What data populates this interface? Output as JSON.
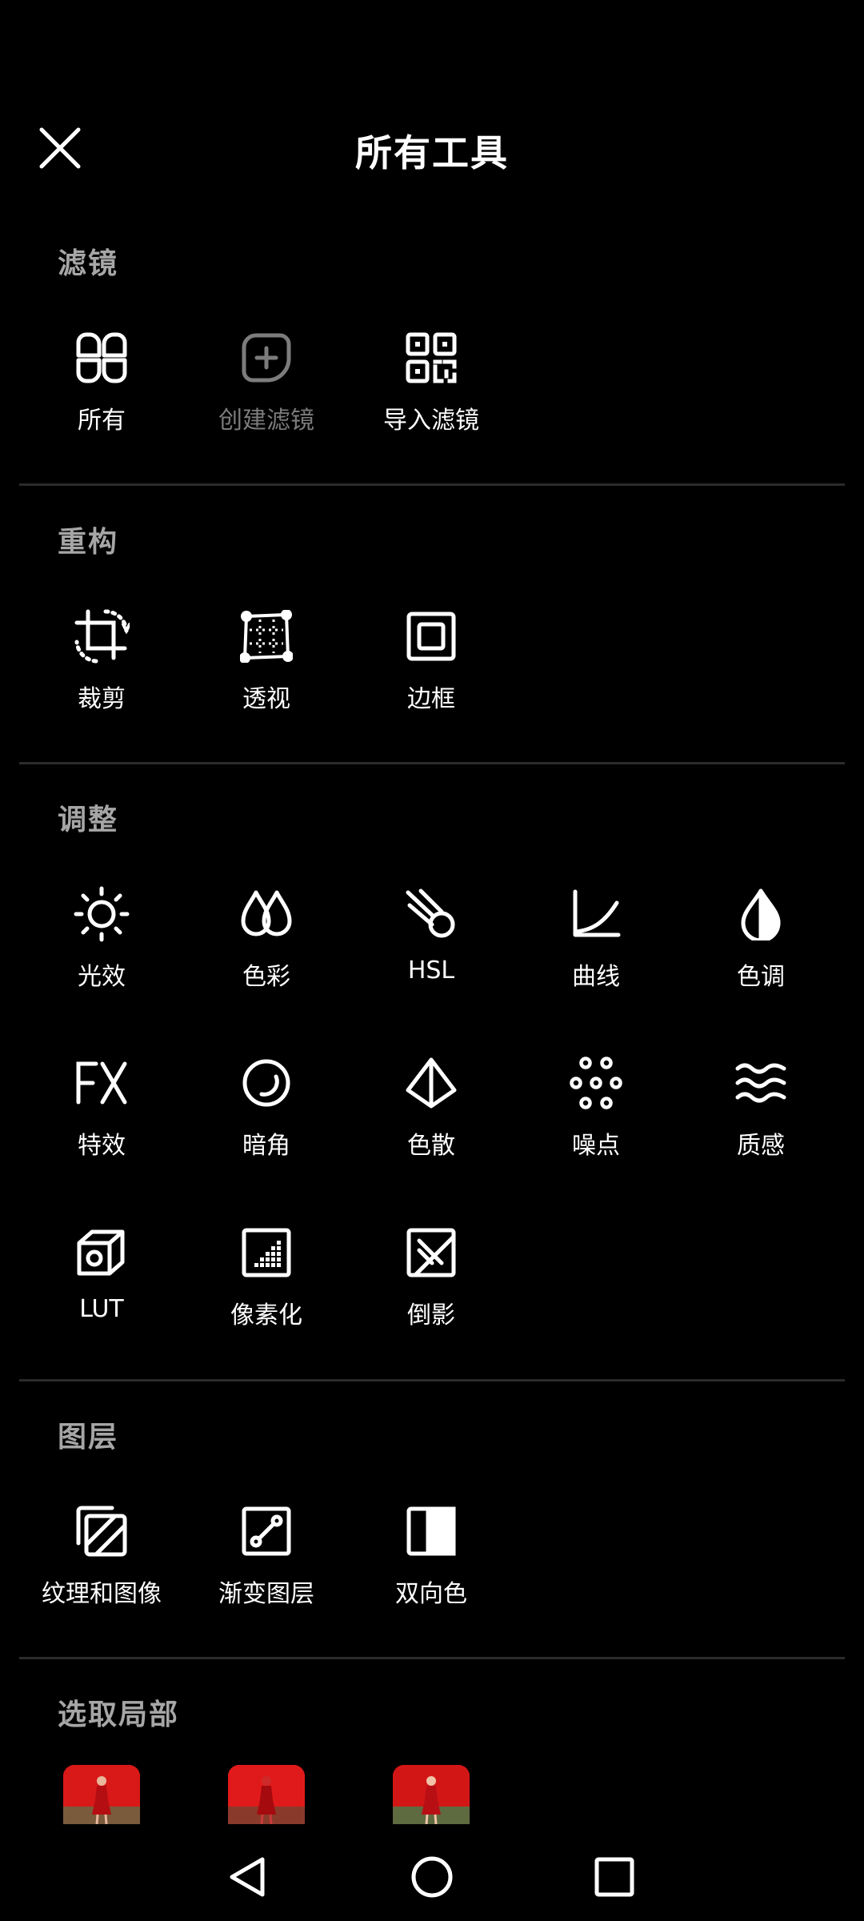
{
  "header": {
    "title": "所有工具",
    "close_icon": "close-icon"
  },
  "sections": {
    "filters": {
      "title": "滤镜",
      "items": [
        {
          "label": "所有",
          "icon": "grid-petals-icon",
          "enabled": true
        },
        {
          "label": "创建滤镜",
          "icon": "add-filter-icon",
          "enabled": false
        },
        {
          "label": "导入滤镜",
          "icon": "qr-code-icon",
          "enabled": true
        }
      ]
    },
    "reconstruct": {
      "title": "重构",
      "items": [
        {
          "label": "裁剪",
          "icon": "crop-rotate-icon"
        },
        {
          "label": "透视",
          "icon": "perspective-grid-icon"
        },
        {
          "label": "边框",
          "icon": "border-frame-icon"
        }
      ]
    },
    "adjust": {
      "title": "调整",
      "items": [
        {
          "label": "光效",
          "icon": "sun-icon"
        },
        {
          "label": "色彩",
          "icon": "color-drops-icon"
        },
        {
          "label": "HSL",
          "icon": "hsl-comet-icon"
        },
        {
          "label": "曲线",
          "icon": "curve-icon"
        },
        {
          "label": "色调",
          "icon": "tone-drop-icon"
        },
        {
          "label": "特效",
          "icon": "fx-icon"
        },
        {
          "label": "暗角",
          "icon": "vignette-icon"
        },
        {
          "label": "色散",
          "icon": "prism-icon"
        },
        {
          "label": "噪点",
          "icon": "noise-dots-icon"
        },
        {
          "label": "质感",
          "icon": "waves-icon"
        },
        {
          "label": "LUT",
          "icon": "lut-cube-icon"
        },
        {
          "label": "像素化",
          "icon": "pixelate-icon"
        },
        {
          "label": "倒影",
          "icon": "reflection-icon"
        }
      ]
    },
    "layers": {
      "title": "图层",
      "items": [
        {
          "label": "纹理和图像",
          "icon": "texture-image-icon"
        },
        {
          "label": "渐变图层",
          "icon": "gradient-layer-icon"
        },
        {
          "label": "双向色",
          "icon": "duotone-icon"
        }
      ]
    },
    "select": {
      "title": "选取局部",
      "thumbnails": [
        "portrait-thumbnail-1",
        "portrait-thumbnail-2",
        "portrait-thumbnail-3"
      ]
    }
  },
  "navbar": {
    "back_icon": "nav-back-icon",
    "home_icon": "nav-home-icon",
    "recents_icon": "nav-recents-icon"
  },
  "colors": {
    "background": "#000000",
    "text": "#ffffff",
    "section_title": "#a6a6a6",
    "disabled": "#7c7c7c",
    "divider": "#2b2b2b"
  }
}
